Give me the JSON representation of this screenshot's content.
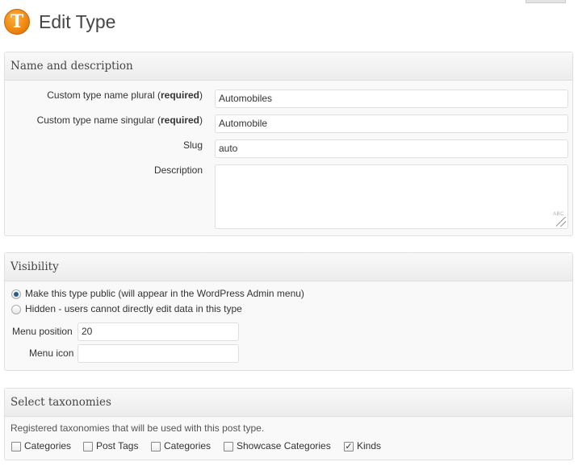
{
  "header": {
    "title": "Edit Type",
    "logo_letter": "T",
    "logo_icon": "types-logo-icon"
  },
  "name_description": {
    "heading": "Name and description",
    "plural_label": "Custom type name plural (",
    "plural_req": "required",
    "plural_close": ")",
    "plural_value": "Automobiles",
    "singular_label": "Custom type name singular (",
    "singular_req": "required",
    "singular_close": ")",
    "singular_value": "Automobile",
    "slug_label": "Slug",
    "slug_value": "auto",
    "description_label": "Description",
    "description_value": "",
    "spellcheck_text": "ABC"
  },
  "visibility": {
    "heading": "Visibility",
    "public_label": "Make this type public (will appear in the WordPress Admin menu)",
    "hidden_label": "Hidden - users cannot directly edit data in this type",
    "selected": "public",
    "menu_position_label": "Menu position",
    "menu_position_value": "20",
    "menu_icon_label": "Menu icon",
    "menu_icon_value": ""
  },
  "taxonomies": {
    "heading": "Select taxonomies",
    "description": "Registered taxonomies that will be used with this post type.",
    "items": [
      {
        "label": "Categories",
        "checked": false
      },
      {
        "label": "Post Tags",
        "checked": false
      },
      {
        "label": "Categories",
        "checked": false
      },
      {
        "label": "Showcase Categories",
        "checked": false
      },
      {
        "label": "Kinds",
        "checked": true
      }
    ],
    "check_mark": "✓"
  }
}
